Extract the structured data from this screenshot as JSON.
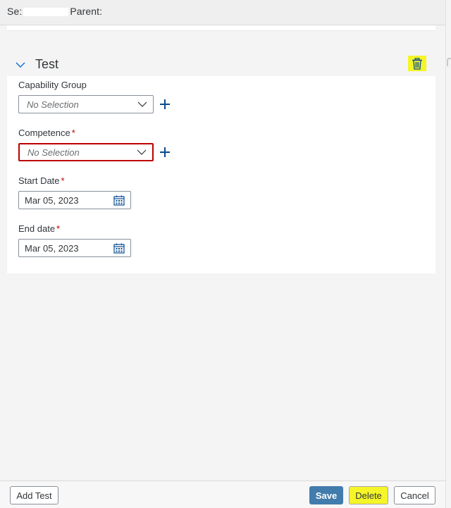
{
  "header": {
    "prefix": "Se:",
    "parent_label": "Parent:"
  },
  "section": {
    "title": "Test"
  },
  "fields": {
    "capability_group": {
      "label": "Capability Group",
      "placeholder": "No Selection"
    },
    "competence": {
      "label": "Competence",
      "required_mark": "*",
      "placeholder": "No Selection"
    },
    "start_date": {
      "label": "Start Date",
      "required_mark": "*",
      "value": "Mar 05, 2023"
    },
    "end_date": {
      "label": "End date",
      "required_mark": "*",
      "value": "Mar 05, 2023"
    }
  },
  "footer": {
    "add_test_label": "Add Test",
    "save_label": "Save",
    "delete_label": "Delete",
    "cancel_label": "Cancel"
  },
  "colors": {
    "accent": "#0a6ed1",
    "save": "#427cac",
    "error": "#bb0000",
    "highlight": "#f5f528"
  },
  "icons": {
    "collapse": "chevron-down-icon",
    "trash": "trash-icon",
    "dropdown": "chevron-down-icon",
    "add": "plus-icon",
    "calendar": "calendar-icon"
  }
}
